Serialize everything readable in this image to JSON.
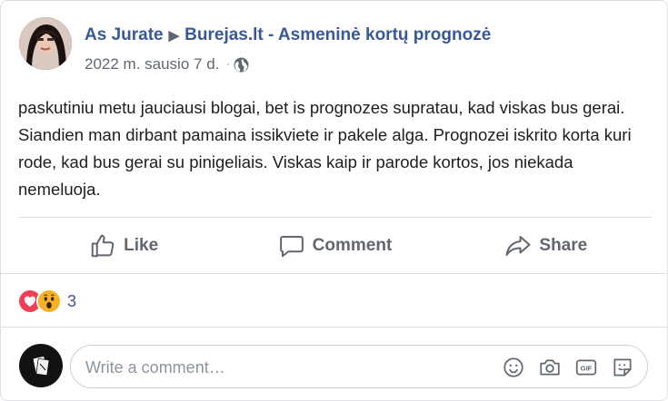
{
  "post": {
    "author": "As Jurate",
    "page": "Burejas.lt - Asmeninė kortų prognozė",
    "date": "2022 m. sausio 7 d.",
    "dot": "·",
    "privacy_icon": "globe-icon",
    "text": "paskutiniu metu jauciausi blogai, bet is prognozes supratau, kad viskas bus gerai. Siandien man dirbant pamaina issikviete ir pakele alga. Prognozei iskrito korta kuri rode, kad bus gerai su pinigeliais. Viskas kaip ir parode kortos, jos niekada nemeluoja."
  },
  "actions": {
    "like": "Like",
    "comment": "Comment",
    "share": "Share"
  },
  "reactions": {
    "types": [
      "love",
      "wow"
    ],
    "count": "3"
  },
  "comment_box": {
    "placeholder": "Write a comment…",
    "icons": [
      "emoji-icon",
      "camera-icon",
      "gif-icon",
      "sticker-icon"
    ]
  },
  "colors": {
    "link": "#385898",
    "muted": "#606770",
    "divider": "#dadde1",
    "love": "#f33e58",
    "wow": "#f7b125"
  }
}
